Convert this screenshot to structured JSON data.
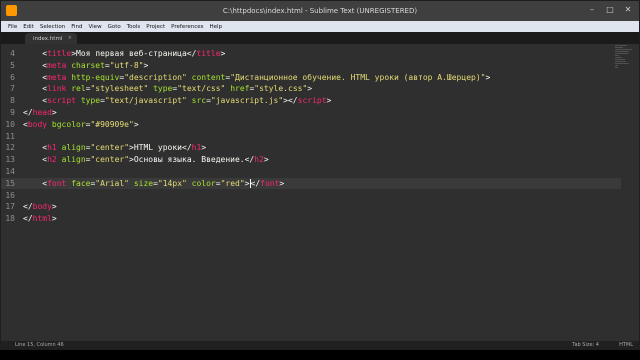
{
  "window": {
    "title": "C:\\httpdocs\\index.html - Sublime Text (UNREGISTERED)"
  },
  "menu": [
    "File",
    "Edit",
    "Selection",
    "Find",
    "View",
    "Goto",
    "Tools",
    "Project",
    "Preferences",
    "Help"
  ],
  "tab": {
    "label": "index.html",
    "close_glyph": "×"
  },
  "code": {
    "active_line": 15,
    "lines": [
      {
        "n": "4",
        "tokens": [
          {
            "t": "    ",
            "c": "plain"
          },
          {
            "t": "<",
            "c": "plain"
          },
          {
            "t": "title",
            "c": "tag"
          },
          {
            "t": ">Моя первая веб-страница</",
            "c": "plain"
          },
          {
            "t": "title",
            "c": "tag"
          },
          {
            "t": ">",
            "c": "plain"
          }
        ]
      },
      {
        "n": "5",
        "tokens": [
          {
            "t": "    ",
            "c": "plain"
          },
          {
            "t": "<",
            "c": "plain"
          },
          {
            "t": "meta",
            "c": "tag"
          },
          {
            "t": " ",
            "c": "plain"
          },
          {
            "t": "charset",
            "c": "attr"
          },
          {
            "t": "=",
            "c": "plain"
          },
          {
            "t": "\"utf-8\"",
            "c": "str"
          },
          {
            "t": ">",
            "c": "plain"
          }
        ]
      },
      {
        "n": "6",
        "tokens": [
          {
            "t": "    ",
            "c": "plain"
          },
          {
            "t": "<",
            "c": "plain"
          },
          {
            "t": "meta",
            "c": "tag"
          },
          {
            "t": " ",
            "c": "plain"
          },
          {
            "t": "http-equiv",
            "c": "attr"
          },
          {
            "t": "=",
            "c": "plain"
          },
          {
            "t": "\"description\"",
            "c": "str"
          },
          {
            "t": " ",
            "c": "plain"
          },
          {
            "t": "content",
            "c": "attr"
          },
          {
            "t": "=",
            "c": "plain"
          },
          {
            "t": "\"Дистанционное обучение. HTML уроки (автор А.Шерцер)\"",
            "c": "str"
          },
          {
            "t": ">",
            "c": "plain"
          }
        ]
      },
      {
        "n": "7",
        "tokens": [
          {
            "t": "    ",
            "c": "plain"
          },
          {
            "t": "<",
            "c": "plain"
          },
          {
            "t": "link",
            "c": "tag"
          },
          {
            "t": " ",
            "c": "plain"
          },
          {
            "t": "rel",
            "c": "attr"
          },
          {
            "t": "=",
            "c": "plain"
          },
          {
            "t": "\"stylesheet\"",
            "c": "str"
          },
          {
            "t": " ",
            "c": "plain"
          },
          {
            "t": "type",
            "c": "attr"
          },
          {
            "t": "=",
            "c": "plain"
          },
          {
            "t": "\"text/css\"",
            "c": "str"
          },
          {
            "t": " ",
            "c": "plain"
          },
          {
            "t": "href",
            "c": "attr"
          },
          {
            "t": "=",
            "c": "plain"
          },
          {
            "t": "\"style.css\"",
            "c": "str"
          },
          {
            "t": ">",
            "c": "plain"
          }
        ]
      },
      {
        "n": "8",
        "tokens": [
          {
            "t": "    ",
            "c": "plain"
          },
          {
            "t": "<",
            "c": "plain"
          },
          {
            "t": "script",
            "c": "tag"
          },
          {
            "t": " ",
            "c": "plain"
          },
          {
            "t": "type",
            "c": "attr"
          },
          {
            "t": "=",
            "c": "plain"
          },
          {
            "t": "\"text/javascript\"",
            "c": "str"
          },
          {
            "t": " ",
            "c": "plain"
          },
          {
            "t": "src",
            "c": "attr"
          },
          {
            "t": "=",
            "c": "plain"
          },
          {
            "t": "\"javascript.js\"",
            "c": "str"
          },
          {
            "t": "></",
            "c": "plain"
          },
          {
            "t": "script",
            "c": "tag"
          },
          {
            "t": ">",
            "c": "plain"
          }
        ]
      },
      {
        "n": "9",
        "tokens": [
          {
            "t": "</",
            "c": "plain"
          },
          {
            "t": "head",
            "c": "tag"
          },
          {
            "t": ">",
            "c": "plain"
          }
        ]
      },
      {
        "n": "10",
        "tokens": [
          {
            "t": "<",
            "c": "plain"
          },
          {
            "t": "body",
            "c": "tag"
          },
          {
            "t": " ",
            "c": "plain"
          },
          {
            "t": "bgcolor",
            "c": "attr"
          },
          {
            "t": "=",
            "c": "plain"
          },
          {
            "t": "\"#90909e\"",
            "c": "str"
          },
          {
            "t": ">",
            "c": "plain"
          }
        ]
      },
      {
        "n": "11",
        "tokens": []
      },
      {
        "n": "12",
        "tokens": [
          {
            "t": "    ",
            "c": "plain"
          },
          {
            "t": "<",
            "c": "plain"
          },
          {
            "t": "h1",
            "c": "tag"
          },
          {
            "t": " ",
            "c": "plain"
          },
          {
            "t": "align",
            "c": "attr"
          },
          {
            "t": "=",
            "c": "plain"
          },
          {
            "t": "\"center\"",
            "c": "str"
          },
          {
            "t": ">HTML уроки</",
            "c": "plain"
          },
          {
            "t": "h1",
            "c": "tag"
          },
          {
            "t": ">",
            "c": "plain"
          }
        ]
      },
      {
        "n": "13",
        "tokens": [
          {
            "t": "    ",
            "c": "plain"
          },
          {
            "t": "<",
            "c": "plain"
          },
          {
            "t": "h2",
            "c": "tag"
          },
          {
            "t": " ",
            "c": "plain"
          },
          {
            "t": "align",
            "c": "attr"
          },
          {
            "t": "=",
            "c": "plain"
          },
          {
            "t": "\"center\"",
            "c": "str"
          },
          {
            "t": ">Основы языка. Введение.</",
            "c": "plain"
          },
          {
            "t": "h2",
            "c": "tag"
          },
          {
            "t": ">",
            "c": "plain"
          }
        ]
      },
      {
        "n": "14",
        "tokens": []
      },
      {
        "n": "15",
        "tokens": [
          {
            "t": "    ",
            "c": "plain"
          },
          {
            "t": "<",
            "c": "plain"
          },
          {
            "t": "font",
            "c": "tag"
          },
          {
            "t": " ",
            "c": "plain"
          },
          {
            "t": "face",
            "c": "attr"
          },
          {
            "t": "=",
            "c": "plain"
          },
          {
            "t": "\"Arial\"",
            "c": "str"
          },
          {
            "t": " ",
            "c": "plain"
          },
          {
            "t": "size",
            "c": "attr"
          },
          {
            "t": "=",
            "c": "plain"
          },
          {
            "t": "\"14px\"",
            "c": "str"
          },
          {
            "t": " ",
            "c": "plain"
          },
          {
            "t": "color",
            "c": "attr"
          },
          {
            "t": "=",
            "c": "plain"
          },
          {
            "t": "\"red\"",
            "c": "str"
          },
          {
            "t": ">",
            "c": "plain"
          },
          {
            "t": "|",
            "c": "cursor"
          },
          {
            "t": "</",
            "c": "plain"
          },
          {
            "t": "font",
            "c": "tag"
          },
          {
            "t": ">",
            "c": "plain"
          }
        ]
      },
      {
        "n": "16",
        "tokens": []
      },
      {
        "n": "17",
        "tokens": [
          {
            "t": "</",
            "c": "plain"
          },
          {
            "t": "body",
            "c": "tag"
          },
          {
            "t": ">",
            "c": "plain"
          }
        ]
      },
      {
        "n": "18",
        "tokens": [
          {
            "t": "</",
            "c": "plain"
          },
          {
            "t": "html",
            "c": "tag"
          },
          {
            "t": ">",
            "c": "plain"
          }
        ]
      }
    ]
  },
  "status": {
    "position": "Line 15, Column 46",
    "tab_size": "Tab Size: 4",
    "syntax": "HTML"
  },
  "colors": {
    "tag": "#f92672",
    "attribute": "#a6e22e",
    "string": "#e6db74",
    "text": "#f8f8f2"
  }
}
